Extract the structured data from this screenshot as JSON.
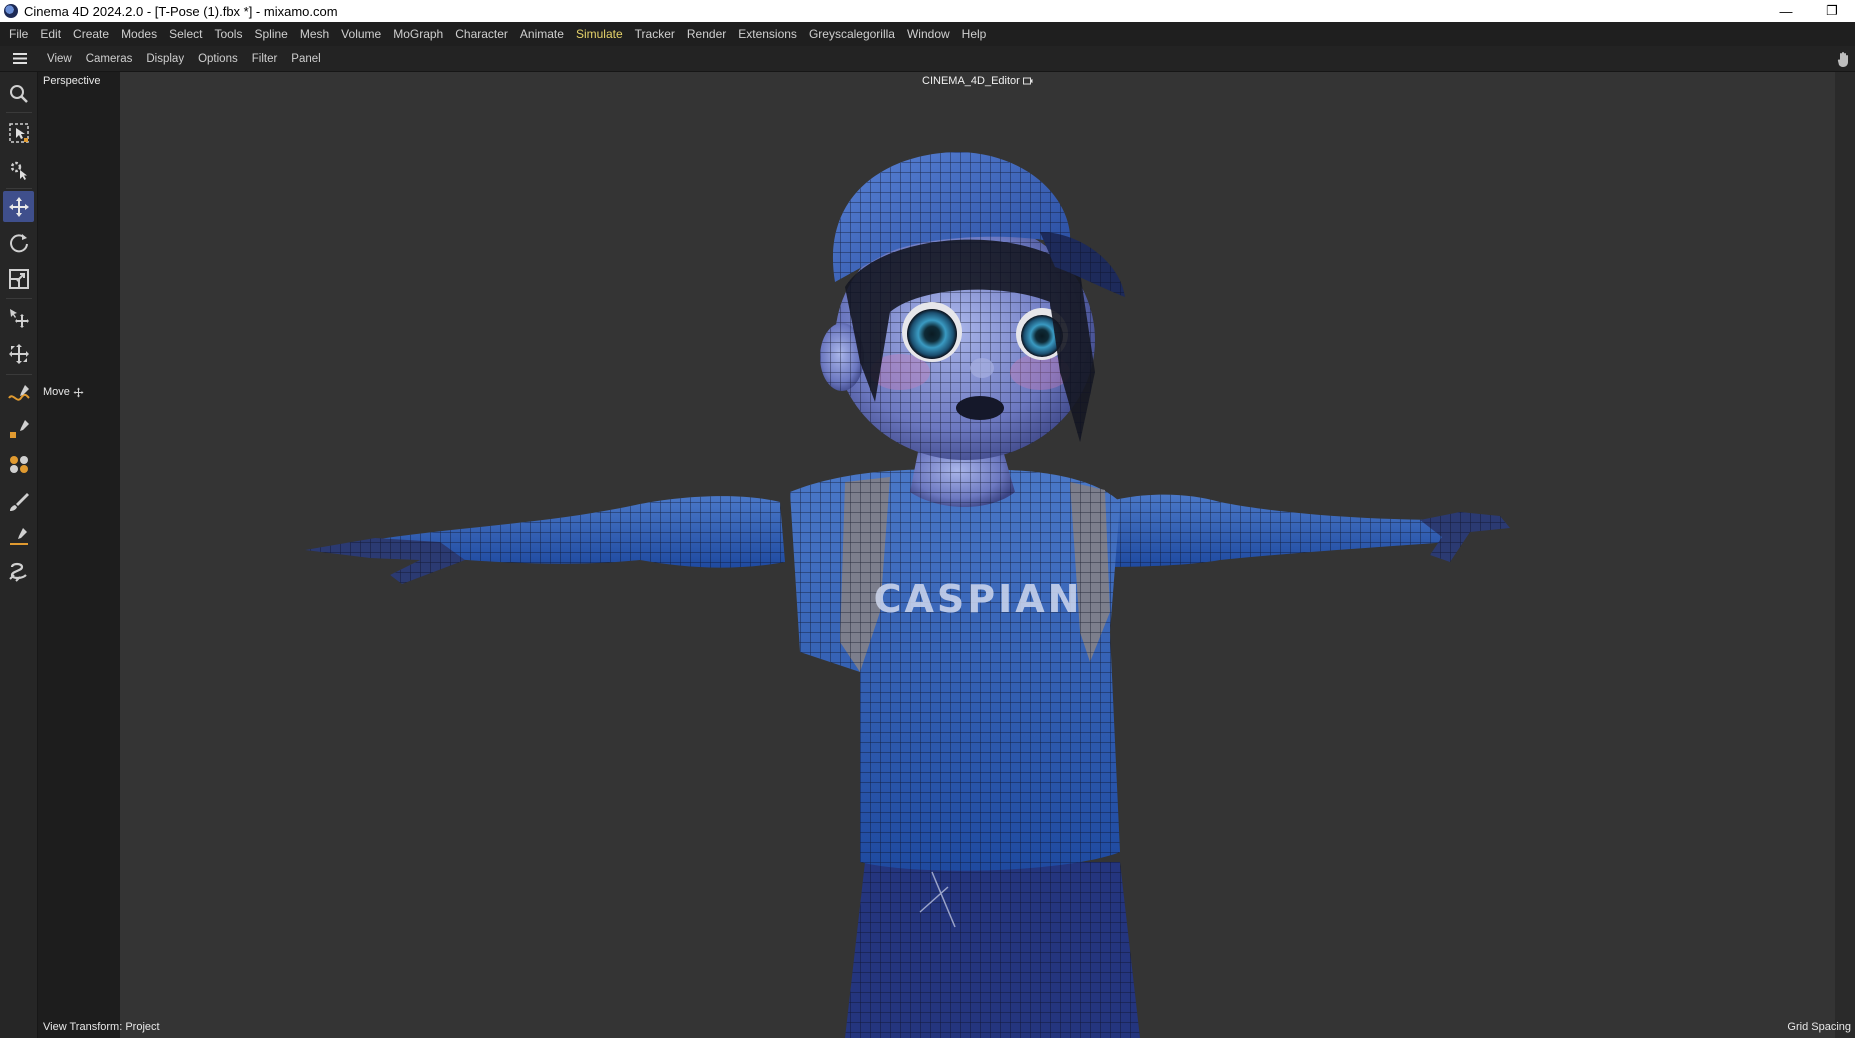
{
  "window": {
    "title": "Cinema 4D 2024.2.0 - [T-Pose (1).fbx *] - mixamo.com",
    "minimize_glyph": "—",
    "restore_glyph": "❐"
  },
  "menubar": {
    "items": [
      "File",
      "Edit",
      "Create",
      "Modes",
      "Select",
      "Tools",
      "Spline",
      "Mesh",
      "Volume",
      "MoGraph",
      "Character",
      "Animate",
      "Simulate",
      "Tracker",
      "Render",
      "Extensions",
      "Greyscalegorilla",
      "Window",
      "Help"
    ],
    "active_item": "Simulate",
    "active_color": "#e6d36a"
  },
  "viewbar": {
    "items": [
      "View",
      "Cameras",
      "Display",
      "Options",
      "Filter",
      "Panel"
    ]
  },
  "viewport": {
    "camera_label": "Perspective",
    "editor_title": "CINEMA_4D_Editor",
    "active_tool_label": "Move",
    "status_left": "View Transform: Project",
    "status_right": "Grid Spacing",
    "shirt_text": "CASPIAN"
  },
  "toolbar": {
    "tools": [
      "search-icon",
      "live-selection-icon",
      "selection-modes-icon",
      "move-icon",
      "rotate-icon",
      "scale-icon",
      "transfer-move-icon",
      "transform-icon",
      "spline-pen-icon",
      "spline-sketch-icon",
      "spline-smooth-icon",
      "brush-icon",
      "spline-arc-icon",
      "lasso-icon"
    ],
    "active_tool": "move-icon",
    "accent_color": "#3f4f8c"
  }
}
